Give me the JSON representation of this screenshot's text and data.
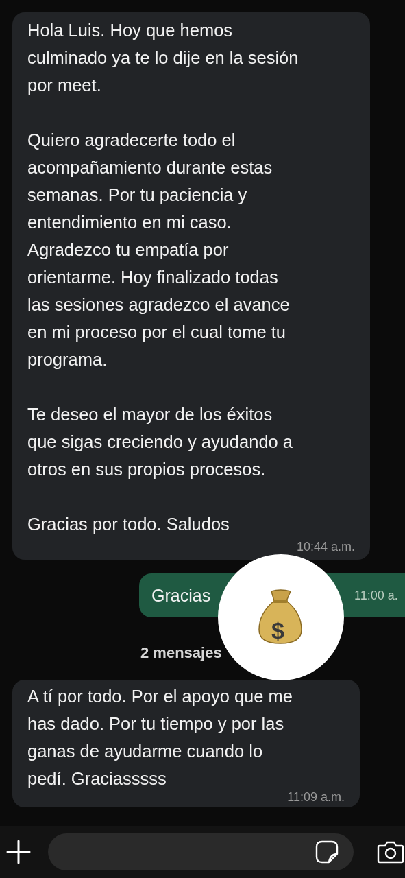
{
  "messages": [
    {
      "kind": "incoming",
      "paragraphs": [
        "Hola Luis. Hoy que hemos\nculminado ya te lo dije en la sesión\npor meet.",
        "Quiero agradecerte todo el\nacompañamiento durante estas\nsemanas. Por tu paciencia y\nentendimiento en mi caso.\nAgradezco tu empatía por\norientarme. Hoy finalizado todas\nlas sesiones agradezco el avance\nen mi proceso por el cual tome tu\nprograma.",
        "Te deseo el mayor de los éxitos\nque sigas creciendo y ayudando a\notros en sus propios procesos.",
        "Gracias por todo. Saludos"
      ],
      "time": "10:44 a.m."
    },
    {
      "kind": "outgoing",
      "paragraphs": [
        "Gracias"
      ],
      "time": "11:00 a."
    },
    {
      "kind": "divider",
      "text": "2 mensajes"
    },
    {
      "kind": "incoming",
      "paragraphs": [
        "A tí por todo. Por el apoyo que me\nhas dado. Por tu tiempo y por las\nganas de ayudarme cuando lo\npedí. Graciasssss"
      ],
      "time": "11:09 a.m."
    }
  ],
  "reaction": {
    "symbol": "$"
  }
}
